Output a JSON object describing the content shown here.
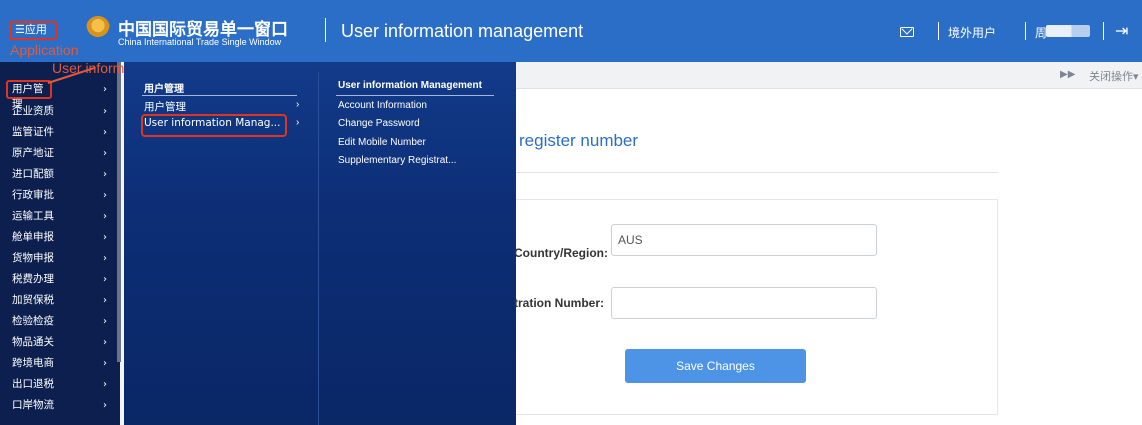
{
  "header": {
    "app_button": "☰应用",
    "app_annotation": "Application",
    "brand_cn": "中国国际贸易单一窗口",
    "brand_en": "China International Trade Single Window",
    "page_title": "User information management",
    "user_type": "境外用户",
    "user_name": "周",
    "logout_icon": "logout-icon",
    "mail_icon": "mail-icon",
    "colors": {
      "header_bg": "#2b6ec7",
      "annotation": "#e0341f"
    }
  },
  "sidebar": {
    "annotation": "User information management",
    "items": [
      {
        "label": "用户管理"
      },
      {
        "label": "企业资质"
      },
      {
        "label": "监管证件"
      },
      {
        "label": "原产地证"
      },
      {
        "label": "进口配额"
      },
      {
        "label": "行政审批"
      },
      {
        "label": "运输工具"
      },
      {
        "label": "舱单申报"
      },
      {
        "label": "货物申报"
      },
      {
        "label": "税费办理"
      },
      {
        "label": "加贸保税"
      },
      {
        "label": "检验检疫"
      },
      {
        "label": "物品通关"
      },
      {
        "label": "跨境电商"
      },
      {
        "label": "出口退税"
      },
      {
        "label": "口岸物流"
      }
    ]
  },
  "submenu": {
    "heading": "用户管理",
    "items": [
      {
        "label": "用户管理"
      },
      {
        "label": "User information Manag..."
      }
    ],
    "detail_heading": "User information Management",
    "detail_items": [
      {
        "label": "Account Information"
      },
      {
        "label": "Change Password"
      },
      {
        "label": "Edit Mobile Number"
      },
      {
        "label": "Supplementary Registrat..."
      }
    ]
  },
  "tabbar": {
    "close_ops": "关闭操作▾",
    "forward_icon": "double-chevron-right-icon"
  },
  "form": {
    "section_title": "register number",
    "country_label": "Country/Region:",
    "country_value": "AUS",
    "registration_label": "tration Number:",
    "registration_value": "",
    "save_button": "Save Changes"
  }
}
